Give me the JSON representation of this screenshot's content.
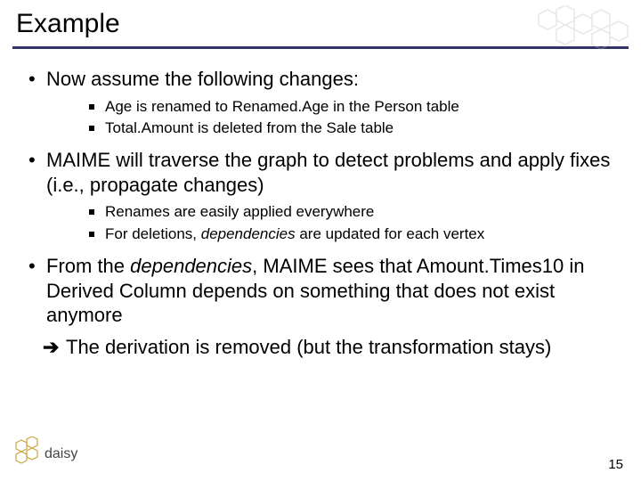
{
  "title": "Example",
  "bullets": {
    "b1": "Now assume the following changes:",
    "b1_sub1": "Age is renamed to Renamed.Age in the Person table",
    "b1_sub2": "Total.Amount is deleted from the Sale table",
    "b2": "MAIME will traverse the graph to detect problems and apply fixes (i.e., propagate changes)",
    "b2_sub1": "Renames are easily applied everywhere",
    "b2_sub2_a": "For deletions, ",
    "b2_sub2_b": "dependencies",
    "b2_sub2_c": " are updated for each vertex",
    "b3_a": "From the ",
    "b3_b": "dependencies",
    "b3_c": ", MAIME sees that Amount.Times10 in Derived Column depends on something that does not exist anymore",
    "b4": "The derivation is removed (but the transformation stays)"
  },
  "logo_text": "daisy",
  "page_number": "15"
}
